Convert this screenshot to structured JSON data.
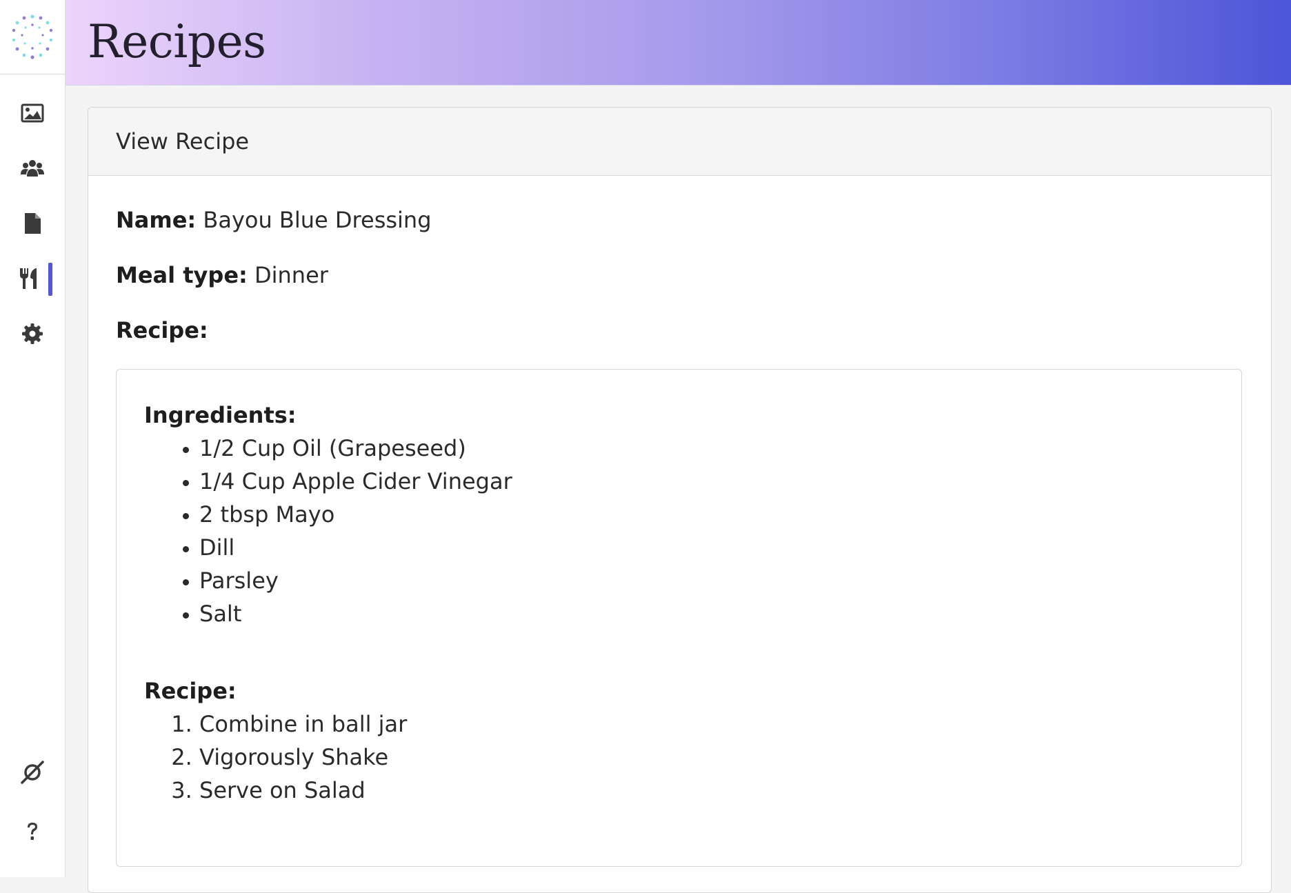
{
  "header": {
    "title": "Recipes"
  },
  "sidebar": {
    "items": [
      {
        "name": "images",
        "icon": "image-icon"
      },
      {
        "name": "users",
        "icon": "users-icon"
      },
      {
        "name": "documents",
        "icon": "file-icon"
      },
      {
        "name": "recipes",
        "icon": "utensils-icon",
        "active": true
      },
      {
        "name": "settings",
        "icon": "gear-icon"
      }
    ],
    "bottom_items": [
      {
        "name": "feedback",
        "icon": "orbit-icon"
      },
      {
        "name": "help",
        "icon": "question-icon"
      }
    ]
  },
  "card": {
    "title": "View Recipe",
    "name_label": "Name:",
    "name_value": "Bayou Blue Dressing",
    "meal_type_label": "Meal type:",
    "meal_type_value": "Dinner",
    "recipe_label": "Recipe:"
  },
  "recipe": {
    "ingredients_title": "Ingredients:",
    "ingredients": [
      "1/2 Cup Oil (Grapeseed)",
      "1/4 Cup Apple Cider Vinegar",
      "2 tbsp Mayo",
      "Dill",
      "Parsley",
      "Salt"
    ],
    "steps_title": "Recipe:",
    "steps": [
      "Combine in ball jar",
      "Vigorously Shake",
      "Serve on Salad"
    ]
  },
  "colors": {
    "accent": "#5656d6",
    "header_gradient_start": "#ecd4fb",
    "header_gradient_end": "#4d55d8",
    "icon": "#3a3a3a"
  }
}
